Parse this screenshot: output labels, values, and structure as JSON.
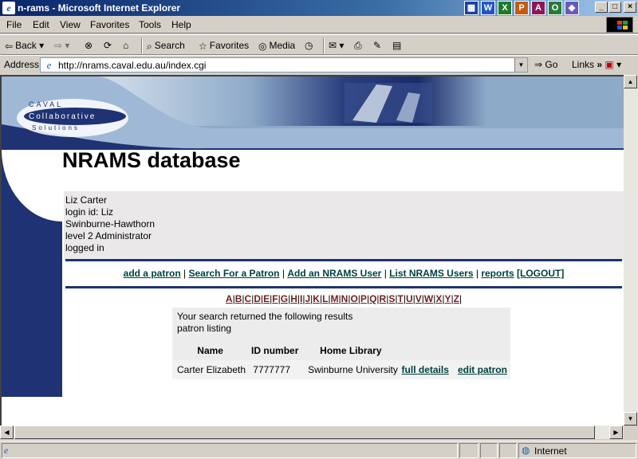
{
  "window": {
    "title": "n-rams - Microsoft Internet Explorer",
    "controls": [
      "_",
      "□",
      "×"
    ]
  },
  "menu": {
    "items": [
      "File",
      "Edit",
      "View",
      "Favorites",
      "Tools",
      "Help"
    ]
  },
  "toolbar": {
    "back": "Back",
    "search": "Search",
    "favorites": "Favorites",
    "media": "Media"
  },
  "address": {
    "label": "Address",
    "url": "http://nrams.caval.edu.au/index.cgi",
    "go": "Go",
    "links": "Links"
  },
  "status": {
    "zone": "Internet"
  },
  "page": {
    "logo": {
      "line1": "CAVAL",
      "line2": "Collaborative",
      "line3": "Solutions"
    },
    "title": "NRAMS database",
    "user": {
      "name": "Liz Carter",
      "login": "login id: Liz",
      "institution": "Swinburne-Hawthorn",
      "level": "level 2 Administrator",
      "status": "logged in"
    },
    "nav": {
      "add_patron": "add a patron",
      "search_patron": "Search For a Patron",
      "add_user": "Add an NRAMS User",
      "list_users": "List NRAMS Users",
      "reports": "reports",
      "logout": "[LOGOUT]",
      "sep": "|"
    },
    "alphabet": [
      "A",
      "B",
      "C",
      "D",
      "E",
      "F",
      "G",
      "H",
      "I",
      "J",
      "K",
      "L",
      "M",
      "N",
      "O",
      "P",
      "Q",
      "R",
      "S",
      "T",
      "U",
      "V",
      "W",
      "X",
      "Y",
      "Z"
    ],
    "results": {
      "message": "Your search returned the following results",
      "subtitle": "patron listing",
      "columns": [
        "Name",
        "ID number",
        "Home Library"
      ],
      "rows": [
        {
          "name": "Carter Elizabeth",
          "id": "7777777",
          "library": "Swinburne University",
          "details": "full details",
          "edit": "edit patron"
        }
      ]
    }
  }
}
